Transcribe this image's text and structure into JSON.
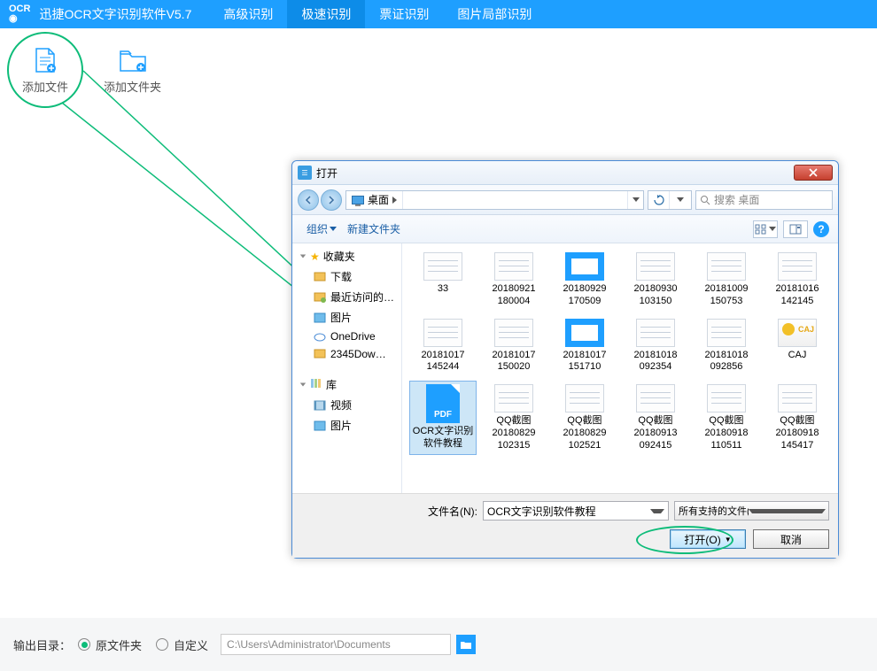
{
  "app": {
    "title": "迅捷OCR文字识别软件V5.7"
  },
  "menu": {
    "items": [
      {
        "label": "高级识别"
      },
      {
        "label": "极速识别",
        "active": true
      },
      {
        "label": "票证识别"
      },
      {
        "label": "图片局部识别"
      }
    ]
  },
  "toolbar": {
    "add_file": "添加文件",
    "add_folder": "添加文件夹"
  },
  "dialog": {
    "title": "打开",
    "location": "桌面",
    "search_placeholder": "搜索 桌面",
    "organize": "组织",
    "new_folder": "新建文件夹",
    "sidebar": {
      "favorites": "收藏夹",
      "downloads": "下载",
      "recent": "最近访问的…",
      "pictures": "图片",
      "onedrive": "OneDrive",
      "folder2345": "2345Dow…",
      "libraries": "库",
      "videos": "视频",
      "pics2": "图片"
    },
    "files": [
      {
        "name": "33",
        "thumb": "doc"
      },
      {
        "name": "20180921180004",
        "thumb": "doc"
      },
      {
        "name": "20180929170509",
        "thumb": "bluedoc"
      },
      {
        "name": "20180930103150",
        "thumb": "doc"
      },
      {
        "name": "20181009150753",
        "thumb": "doc"
      },
      {
        "name": "20181016142145",
        "thumb": "doc"
      },
      {
        "name": "20181017145244",
        "thumb": "doc"
      },
      {
        "name": "20181017150020",
        "thumb": "doc"
      },
      {
        "name": "20181017151710",
        "thumb": "bluedoc"
      },
      {
        "name": "20181018092354",
        "thumb": "doc"
      },
      {
        "name": "20181018092856",
        "thumb": "doc"
      },
      {
        "name": "CAJ",
        "thumb": "caj"
      },
      {
        "name": "OCR文字识别软件教程",
        "thumb": "pdf",
        "selected": true
      },
      {
        "name": "QQ截图20180829102315",
        "thumb": "doc"
      },
      {
        "name": "QQ截图20180829102521",
        "thumb": "doc"
      },
      {
        "name": "QQ截图20180913092415",
        "thumb": "doc"
      },
      {
        "name": "QQ截图20180918110511",
        "thumb": "doc"
      },
      {
        "name": "QQ截图20180918145417",
        "thumb": "doc"
      }
    ],
    "filename_label": "文件名(N):",
    "filename_value": "OCR文字识别软件教程",
    "filetype": "所有支持的文件(*.pdf;*.png;*.j",
    "open_btn": "打开(O)",
    "cancel_btn": "取消"
  },
  "bottom": {
    "out_label": "输出目录：",
    "original": "原文件夹",
    "custom": "自定义",
    "path": "C:\\Users\\Administrator\\Documents"
  }
}
